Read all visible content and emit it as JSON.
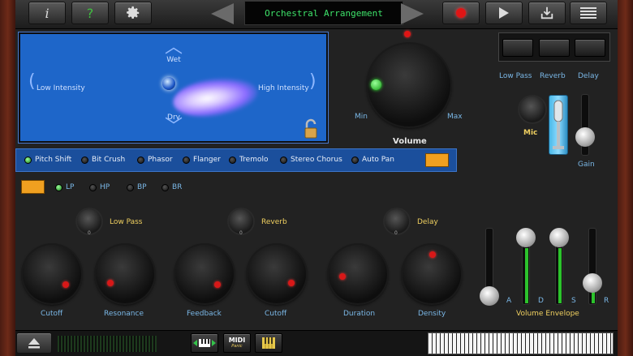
{
  "topbar": {
    "info_label": "i",
    "help_label": "?",
    "title": "Orchestral Arrangement"
  },
  "xypad": {
    "top": "Wet",
    "bottom": "Dry",
    "left": "Low Intensity",
    "right": "High Intensity"
  },
  "volume": {
    "min": "Min",
    "max": "Max",
    "label": "Volume"
  },
  "mic_section": {
    "buttons": [
      "Low Pass",
      "Reverb",
      "Delay"
    ],
    "mic_label": "Mic",
    "gain_label": "Gain"
  },
  "fx": {
    "items": [
      {
        "label": "Pitch Shift",
        "on": true
      },
      {
        "label": "Bit Crush",
        "on": false
      },
      {
        "label": "Phasor",
        "on": false
      },
      {
        "label": "Flanger",
        "on": false
      },
      {
        "label": "Tremolo",
        "on": false
      },
      {
        "label": "Stereo Chorus",
        "on": false
      },
      {
        "label": "Auto Pan",
        "on": false
      }
    ]
  },
  "filter": {
    "items": [
      {
        "label": "LP",
        "on": true
      },
      {
        "label": "HP",
        "on": false
      },
      {
        "label": "BP",
        "on": false
      },
      {
        "label": "BR",
        "on": false
      }
    ]
  },
  "sections": {
    "lowpass": {
      "title": "Low Pass",
      "value": "0",
      "k1": "Cutoff",
      "k2": "Resonance"
    },
    "reverb": {
      "title": "Reverb",
      "value": "0",
      "k1": "Feedback",
      "k2": "Cutoff"
    },
    "delay": {
      "title": "Delay",
      "value": "0",
      "k1": "Duration",
      "k2": "Density"
    }
  },
  "envelope": {
    "title": "Volume Envelope",
    "a": "A",
    "d": "D",
    "s": "S",
    "r": "R"
  },
  "bottombar": {
    "midi_label": "MIDI",
    "panic_label": "Panic"
  }
}
